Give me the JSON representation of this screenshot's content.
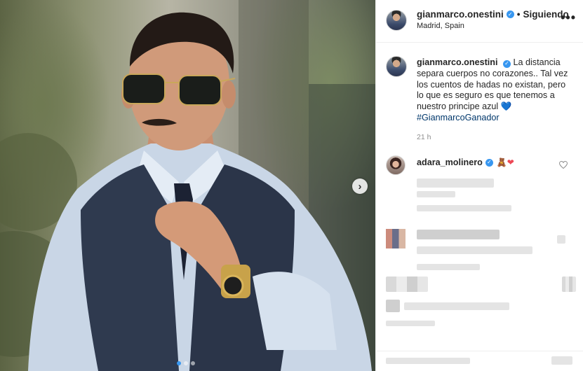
{
  "header": {
    "username": "gianmarco.onestini",
    "separator": "•",
    "follow_status": "Siguiendo",
    "location": "Madrid, Spain",
    "more": "•••"
  },
  "verified_badge": "✓",
  "carousel": {
    "next": "›",
    "dots": 3,
    "active_dot": 1
  },
  "caption": {
    "username": "gianmarco.onestini",
    "text": "La distancia separa cuerpos no corazones.. Tal vez los cuentos de hadas no existan, pero lo que es seguro es que tenemos a nuestro principe azul",
    "emoji": "💙",
    "hashtag": "#GianmarcoGanador",
    "time": "21 h"
  },
  "comments": [
    {
      "username": "adara_molinero",
      "emoji_bear": "🧸",
      "emoji_heart": "❤"
    }
  ],
  "icons": {
    "like": "heart-outline-icon",
    "next": "chevron-right-icon",
    "verified": "verified-badge-icon",
    "more": "more-options-icon"
  },
  "colors": {
    "accent": "#3897f0",
    "hashtag": "#00376b",
    "text": "#262626",
    "muted": "#8e8e8e"
  }
}
